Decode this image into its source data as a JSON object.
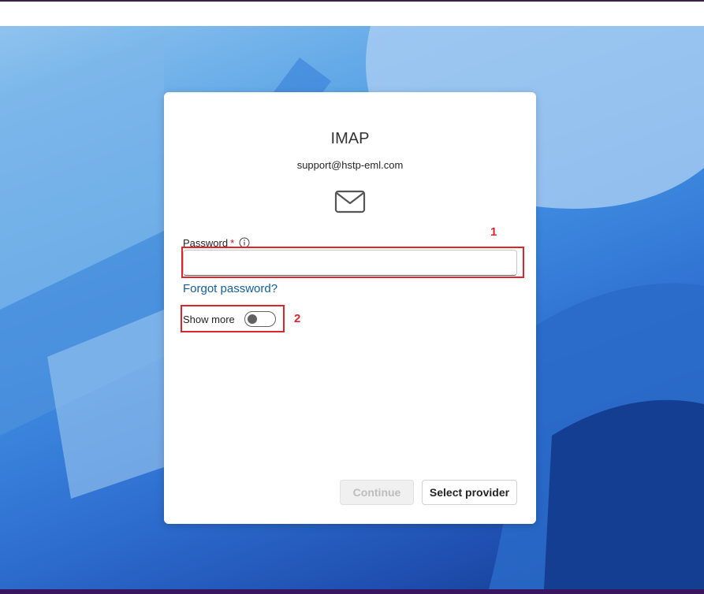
{
  "dialog": {
    "title": "IMAP",
    "email": "support@hstp-eml.com",
    "password_label": "Password",
    "required_mark": "*",
    "password_value": "",
    "forgot_link": "Forgot password?",
    "show_more_label": "Show more",
    "show_more_on": false,
    "continue_label": "Continue",
    "continue_enabled": false,
    "select_provider_label": "Select provider"
  },
  "annotations": [
    {
      "label": "1"
    },
    {
      "label": "2"
    }
  ],
  "colors": {
    "annotation": "#e0242c",
    "link": "#115ea3",
    "required": "#c50f1f"
  }
}
